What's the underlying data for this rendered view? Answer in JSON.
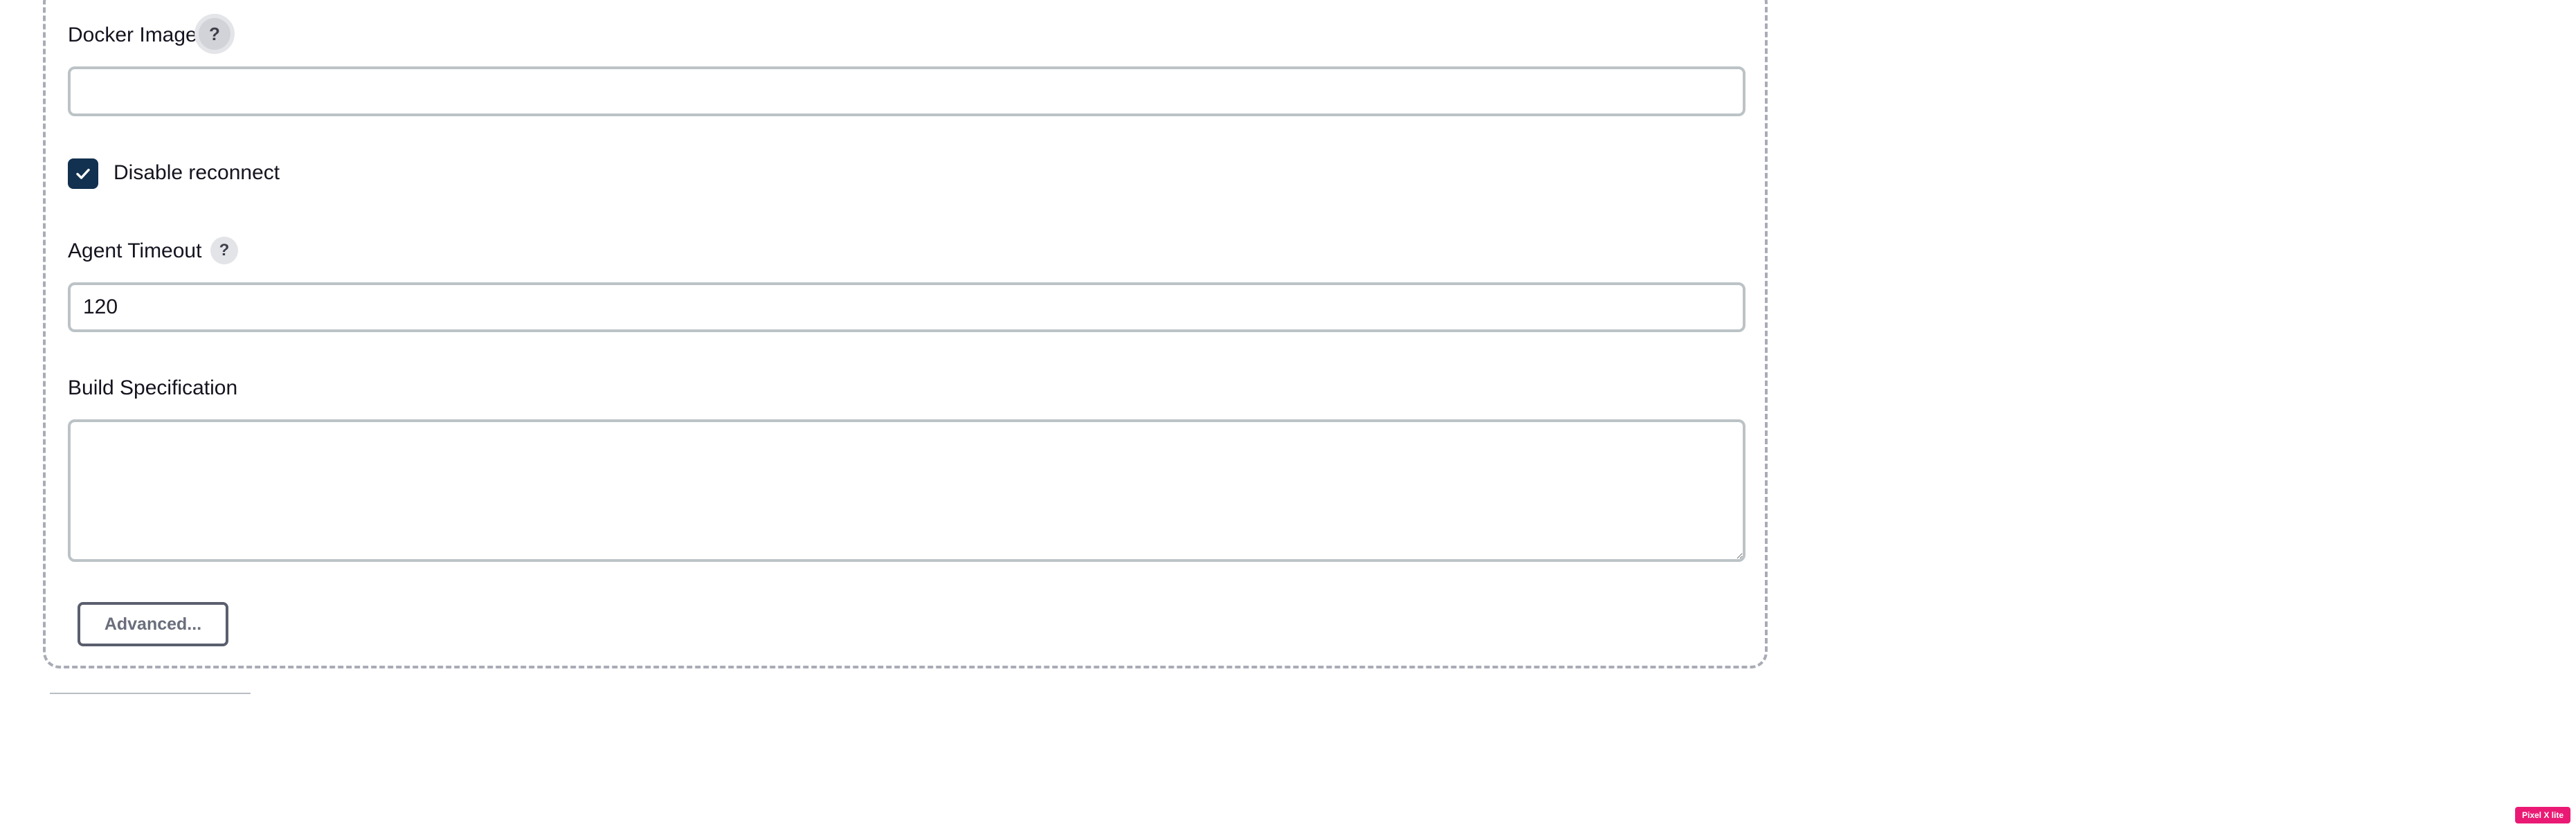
{
  "form": {
    "docker_image": {
      "label": "Docker Image",
      "help_icon": "question-mark-icon",
      "help_glyph": "?",
      "value": ""
    },
    "disable_reconnect": {
      "label": "Disable reconnect",
      "checked": true,
      "check_icon": "checkmark-icon"
    },
    "agent_timeout": {
      "label": "Agent Timeout",
      "help_icon": "question-mark-icon",
      "help_glyph": "?",
      "value": "120"
    },
    "build_specification": {
      "label": "Build Specification",
      "value": ""
    },
    "advanced_button": {
      "label": "Advanced..."
    }
  },
  "badge": {
    "label": "Pixel X lite"
  },
  "colors": {
    "checkbox_fill": "#12304f",
    "badge_fill": "#ea1a74",
    "input_border": "#bcc3c6",
    "panel_border": "#a9acb6"
  }
}
